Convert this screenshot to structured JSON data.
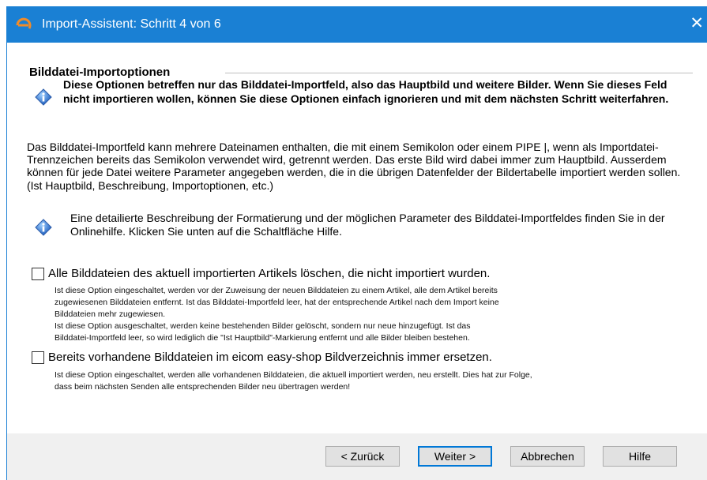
{
  "window": {
    "title": "Import-Assistent: Schritt 4 von 6",
    "close_glyph": "✕",
    "app_icon": "eicom-logo-icon",
    "accent_color": "#1a80d4"
  },
  "section": {
    "header": "Bilddatei-Importoptionen",
    "info_text": "Diese Optionen betreffen nur das Bilddatei-Importfeld, also das Hauptbild und weitere Bilder. Wenn Sie dieses Feld nicht importieren wollen, können Sie diese Optionen einfach ignorieren und mit dem nächsten Schritt weiterfahren.",
    "paragraph": "Das Bilddatei-Importfeld kann mehrere Dateinamen enthalten, die mit einem Semikolon oder einem PIPE |, wenn als Importdatei-Trennzeichen bereits das Semikolon verwendet wird, getrennt werden. Das erste Bild wird dabei immer zum Hauptbild. Ausserdem können für jede Datei weitere Parameter angegeben werden, die in die übrigen Datenfelder der Bildertabelle importiert werden sollen. (Ist Hauptbild, Beschreibung, Importoptionen, etc.)",
    "info_text_2": "Eine detailierte Beschreibung der Formatierung und der möglichen Parameter des Bilddatei-Importfeldes finden Sie in der Onlinehilfe. Klicken Sie unten auf die Schaltfläche Hilfe."
  },
  "options": [
    {
      "label": "Alle Bilddateien des aktuell importierten Artikels löschen, die nicht importiert wurden.",
      "checked": false,
      "description": [
        "Ist diese Option eingeschaltet, werden vor der Zuweisung der neuen Bilddateien zu einem Artikel, alle dem Artikel bereits",
        "zugewiesenen Bilddateien entfernt. Ist das Bilddatei-Importfeld leer, hat der entsprechende Artikel nach dem Import keine",
        "Bilddateien mehr zugewiesen.",
        "Ist diese Option ausgeschaltet, werden keine bestehenden Bilder gelöscht, sondern nur neue hinzugefügt. Ist das",
        "Bilddatei-Importfeld leer, so wird lediglich die \"Ist Hauptbild\"-Markierung entfernt und alle Bilder bleiben bestehen."
      ]
    },
    {
      "label": "Bereits vorhandene Bilddateien im eicom easy-shop Bildverzeichnis immer ersetzen.",
      "checked": false,
      "description": [
        "Ist diese Option eingeschaltet, werden alle vorhandenen Bilddateien, die aktuell importiert werden, neu erstellt. Dies hat zur Folge,",
        "dass beim nächsten Senden alle entsprechenden Bilder neu übertragen werden!"
      ]
    }
  ],
  "buttons": {
    "back": "< Zurück",
    "next": "Weiter >",
    "cancel": "Abbrechen",
    "help": "Hilfe"
  }
}
